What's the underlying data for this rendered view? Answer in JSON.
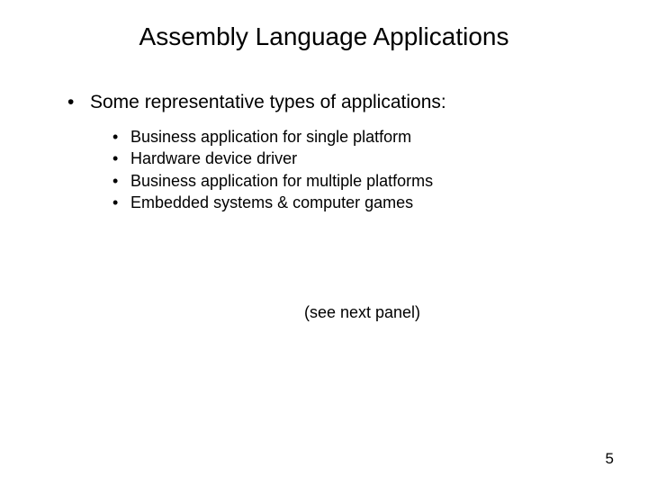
{
  "title": "Assembly Language Applications",
  "mainBullet": "Some representative types of applications:",
  "subBullets": [
    "Business application for single platform",
    "Hardware device driver",
    "Business application for multiple platforms",
    "Embedded systems & computer games"
  ],
  "note": "(see next panel)",
  "pageNumber": "5"
}
